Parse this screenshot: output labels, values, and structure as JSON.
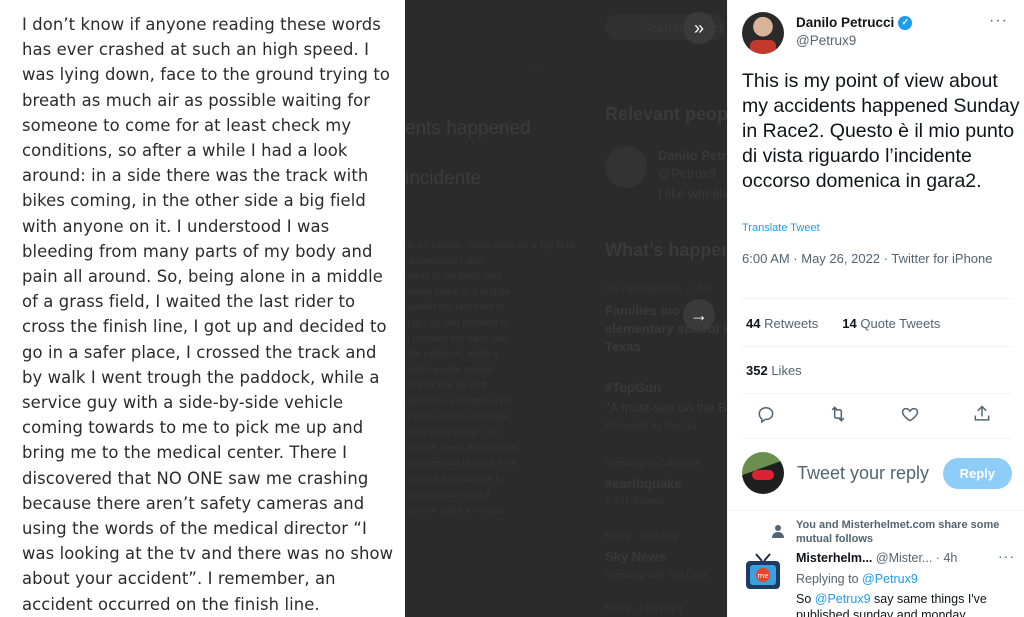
{
  "media": {
    "text": "I don’t know if anyone reading these words has ever crashed at such an high speed. I was lying down, face to the ground trying to breath as much air as possible waiting for someone to come for at least check my conditions, so after a while I had a look around: in a side there was the track with bikes coming, in the other side a big field with anyone on it. I understood I was bleeding from many parts of my body and pain all around. So, being alone in a middle of a grass field, I waited the last rider to cross the finish line, I got up and decided to go in a safer place, I crossed the track and by walk I went trough the paddock, while a service guy with a side-by-side vehicle coming towards to me to pick me up and bring me to the medical center. There I discovered that NO ONE saw me crashing because there aren’t safety cameras and using the words of the medical director “I was looking at the tv and there was no show about your accident”. I remember, an accident occurred on the finish line."
  },
  "backdrop": {
    "search_placeholder": "Search Twitter",
    "more": "···",
    "title_fragment1": "ents happened",
    "title_fragment2": "incidente",
    "relevant_people": "Relevant peop",
    "rel_name": "Danilo Petr",
    "rel_handle": "@Petrux9",
    "rel_bio": "I like wheelie",
    "whats_happening": "What’s happen",
    "trend1_cat": "US national news · LIVE",
    "trend1_title": "Families mo",
    "trend1_title2": "elementary school s",
    "trend1_title3": "Texas",
    "trend2_tag": "#TopGun",
    "trend2_desc": "\"A must-see on the B",
    "trend2_promo": "Promoted by Top Gu",
    "trend3_cat": "Trending in California",
    "trend3_tag": "#earthquake",
    "trend3_count": "6,301 Tweets",
    "trend4_cat": "News · Trending",
    "trend4_title": "Sky News",
    "trend4_with": "Trending with Ted Cruz",
    "trend5_cat": "News · Last night",
    "ghost_lines": [
      "in un campo. Sono stato on a big field",
      "understood I was",
      "parts of my body and",
      "being alone in a middle",
      "waited the last rider to",
      "I got up and decided to",
      "I crossed the track and",
      "the paddock, while a",
      "side-by-side vehicle",
      "to pick me up and",
      "pensavo. Ho capito che",
      "l'avevo dolore ovunque.",
      "solo in un campo, mi",
      "chiede che l'ultimo pilota",
      "attraversato la pista e mi",
      "verso il traguardo e lo",
      "camminato verso il",
      "con un quad a venuto"
    ]
  },
  "tweet": {
    "author_name": "Danilo Petrucci",
    "author_handle": "@Petrux9",
    "more_label": "···",
    "body": "This is my point of view about my accidents happened Sunday in Race2. Questo è il mio punto di vista riguardo l’incidente occorso domenica in gara2.",
    "translate_label": "Translate Tweet",
    "timestamp": "6:00 AM · May 26, 2022 · Twitter for iPhone",
    "retweets_count": "44",
    "retweets_label": "Retweets",
    "quotes_count": "14",
    "quotes_label": "Quote Tweets",
    "likes_count": "352",
    "likes_label": "Likes"
  },
  "reply_box": {
    "placeholder": "Tweet your reply",
    "button_label": "Reply"
  },
  "reply": {
    "social_context": "You and Misterhelmet.com share some mutual follows",
    "name": "Misterhelm...",
    "handle": "@Mister...",
    "time": "· 4h",
    "more_label": "···",
    "replying_prefix": "Replying to ",
    "replying_to": "@Petrux9",
    "text_prefix": "So ",
    "text_mention": "@Petrux9",
    "text_rest": " say same things I've published sunday and monday"
  },
  "colors": {
    "accent": "#1d9bf0",
    "reply_button_disabled": "#8ecdf8",
    "backdrop": "#2b2b2b"
  },
  "icons": [
    "verified-badge-icon",
    "more-icon",
    "collapse-panel-icon",
    "next-arrow-icon",
    "reply-icon",
    "retweet-icon",
    "like-icon",
    "share-icon",
    "person-icon",
    "tv-logo-icon",
    "search-icon"
  ]
}
